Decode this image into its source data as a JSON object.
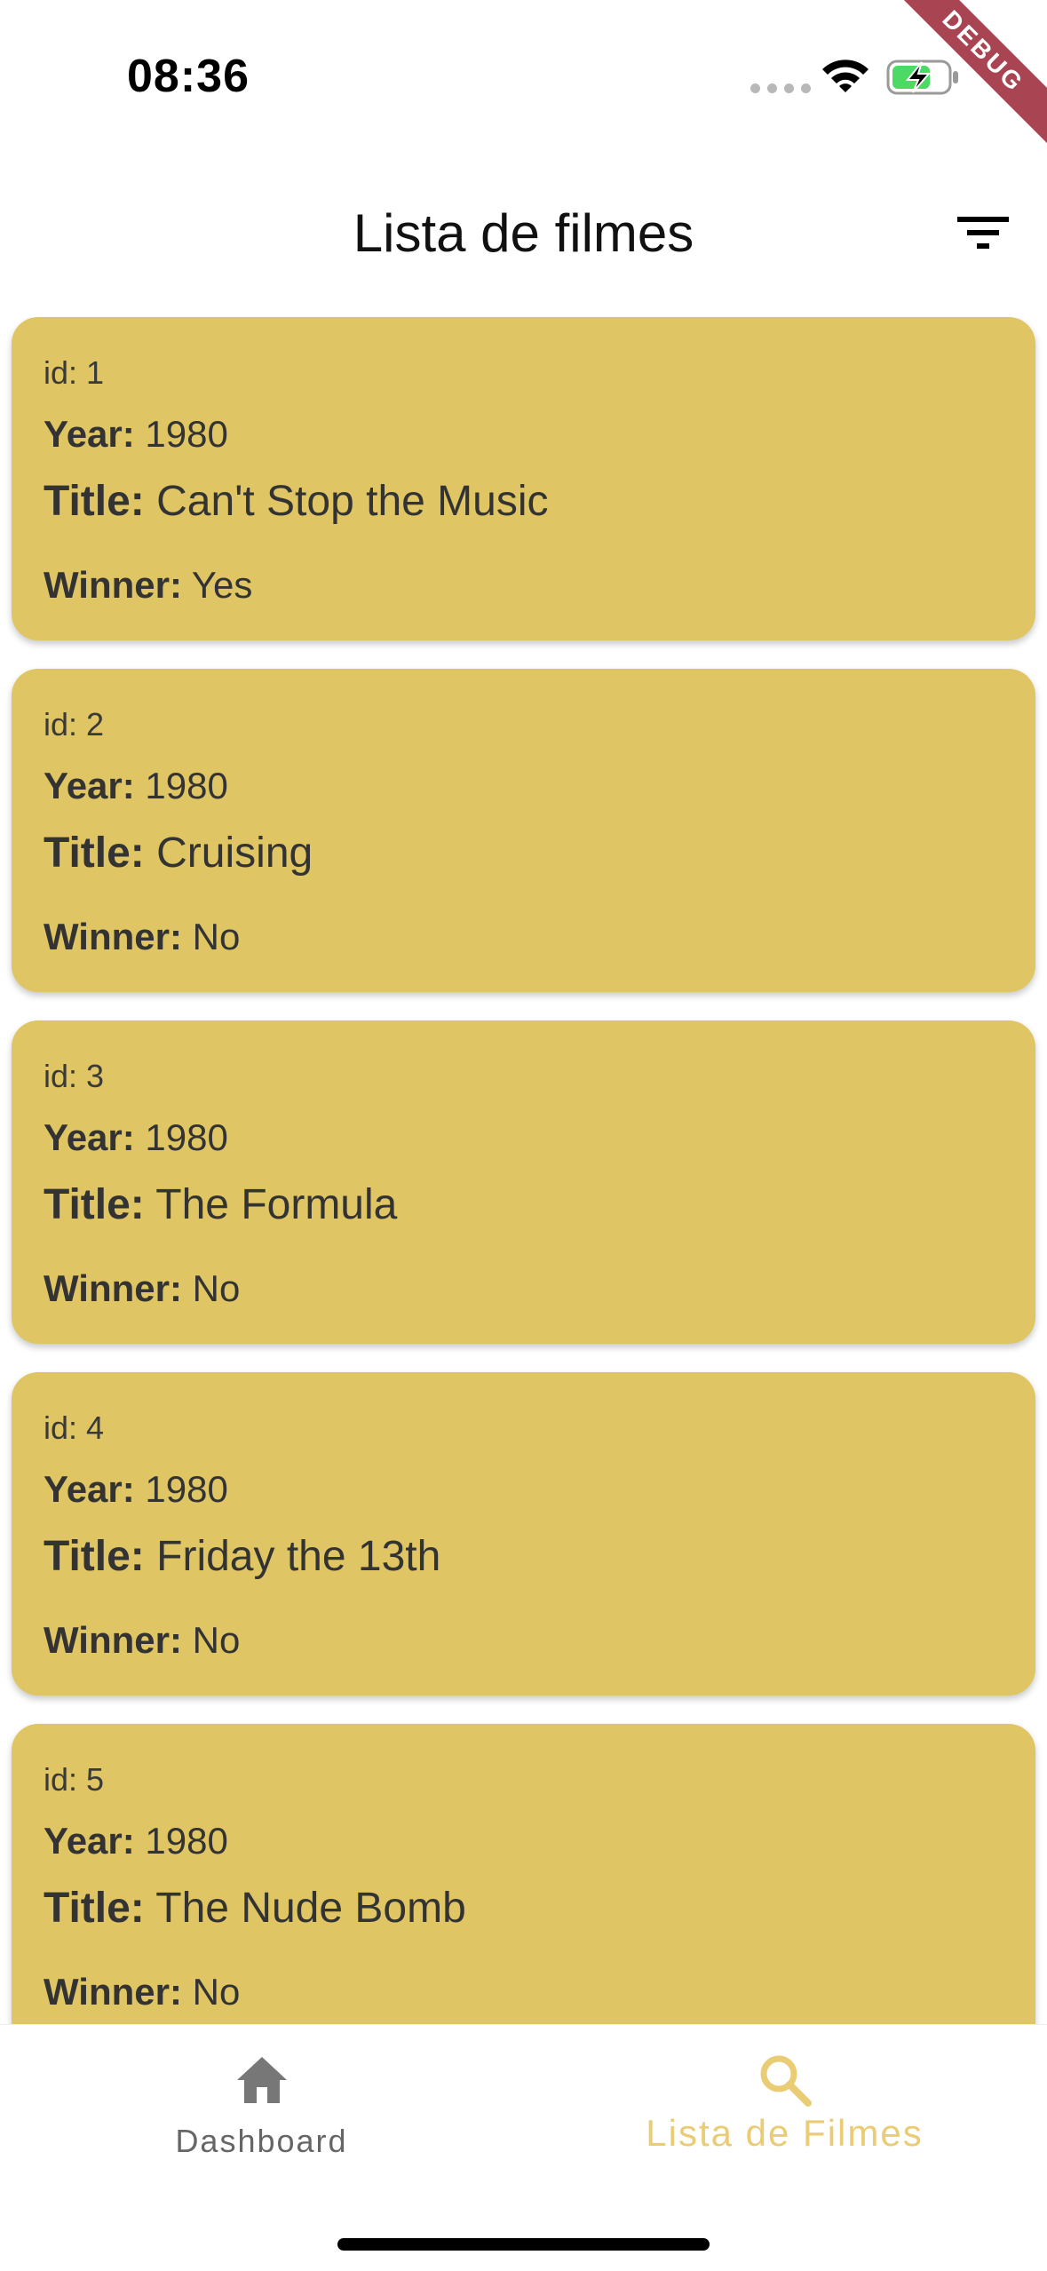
{
  "status_bar": {
    "time": "08:36",
    "debug_label": "DEBUG"
  },
  "app_bar": {
    "title": "Lista de filmes",
    "filter_icon": "filter-icon"
  },
  "labels": {
    "id": "id:",
    "year": "Year:",
    "title": "Title:",
    "winner": "Winner:"
  },
  "movies": [
    {
      "id": "1",
      "year": "1980",
      "title": "Can't Stop the Music",
      "winner": "Yes"
    },
    {
      "id": "2",
      "year": "1980",
      "title": "Cruising",
      "winner": "No"
    },
    {
      "id": "3",
      "year": "1980",
      "title": "The Formula",
      "winner": "No"
    },
    {
      "id": "4",
      "year": "1980",
      "title": "Friday the 13th",
      "winner": "No"
    },
    {
      "id": "5",
      "year": "1980",
      "title": "The Nude Bomb",
      "winner": "No"
    }
  ],
  "bottom_nav": {
    "items": [
      {
        "label": "Dashboard",
        "icon": "home-icon",
        "active": false
      },
      {
        "label": "Lista de Filmes",
        "icon": "search-icon",
        "active": true
      }
    ]
  },
  "colors": {
    "card": "#dfc563",
    "active_nav": "#e9cc74",
    "inactive_nav": "#666666",
    "debug_banner": "#a94452"
  }
}
